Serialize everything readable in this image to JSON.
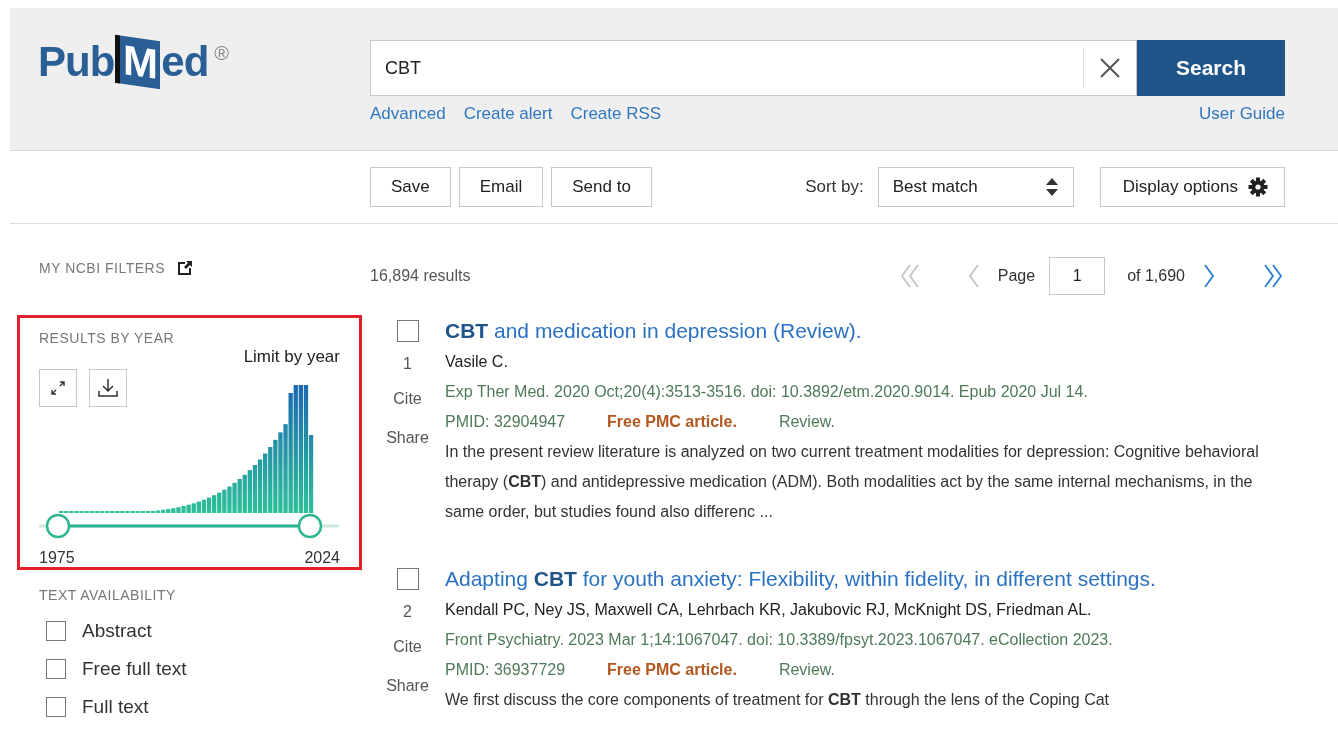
{
  "header": {
    "logo": {
      "text": "PubMed",
      "registered": "®"
    },
    "search": {
      "value": "CBT"
    },
    "search_button": "Search",
    "links": [
      "Advanced",
      "Create alert",
      "Create RSS"
    ],
    "user_guide": "User Guide"
  },
  "toolbar": {
    "actions": [
      "Save",
      "Email",
      "Send to"
    ],
    "sort_label": "Sort by:",
    "sort_value": "Best match",
    "display_options": "Display options"
  },
  "sidebar": {
    "my_ncbi_filters": "MY NCBI FILTERS",
    "results_by_year": {
      "title": "RESULTS BY YEAR",
      "limit_label": "Limit by year",
      "start_year": "1975",
      "end_year": "2024",
      "highlighted": true
    },
    "text_availability": {
      "title": "TEXT AVAILABILITY",
      "options": [
        {
          "label": "Abstract",
          "checked": false
        },
        {
          "label": "Free full text",
          "checked": false
        },
        {
          "label": "Full text",
          "checked": false
        }
      ]
    }
  },
  "results": {
    "count": "16,894 results",
    "pagination": {
      "nav": [
        {
          "kind": "first",
          "disabled": true
        },
        {
          "kind": "previous",
          "disabled": true
        },
        {
          "kind": "next",
          "disabled": false
        },
        {
          "kind": "last",
          "disabled": false
        }
      ],
      "page_label": "Page",
      "page": "1",
      "total": "of 1,690"
    },
    "items": [
      {
        "checked": false,
        "number": "1",
        "actions": [
          "Cite",
          "Share"
        ],
        "title": "**CBT** and medication in depression (Review).",
        "authors": "Vasile C.",
        "citation": "Exp Ther Med. 2020 Oct;20(4):3513-3516. doi: 10.3892/etm.2020.9014. Epub 2020 Jul 14.",
        "pmid": "PMID: 32904947",
        "free_pmc": "Free PMC article.",
        "type": "Review.",
        "snippet": "In the present review literature is analyzed on two current treatment modalities for depression: Cognitive behavioral therapy (**CBT**) and antidepressive medication (ADM). Both modalities act by the same internal mechanisms, in the same order, but studies found also differenc ..."
      },
      {
        "checked": false,
        "number": "2",
        "actions": [
          "Cite",
          "Share"
        ],
        "title": "Adapting **CBT** for youth anxiety: Flexibility, within fidelity, in different settings.",
        "authors": "Kendall PC, Ney JS, Maxwell CA, Lehrbach KR, Jakubovic RJ, McKnight DS, Friedman AL.",
        "citation": "Front Psychiatry. 2023 Mar 1;14:1067047. doi: 10.3389/fpsyt.2023.1067047. eCollection 2023.",
        "pmid": "PMID: 36937729",
        "free_pmc": "Free PMC article.",
        "type": "Review.",
        "snippet": "We first discuss the core components of treatment for **CBT** through the lens of the Coping Cat"
      }
    ]
  }
}
